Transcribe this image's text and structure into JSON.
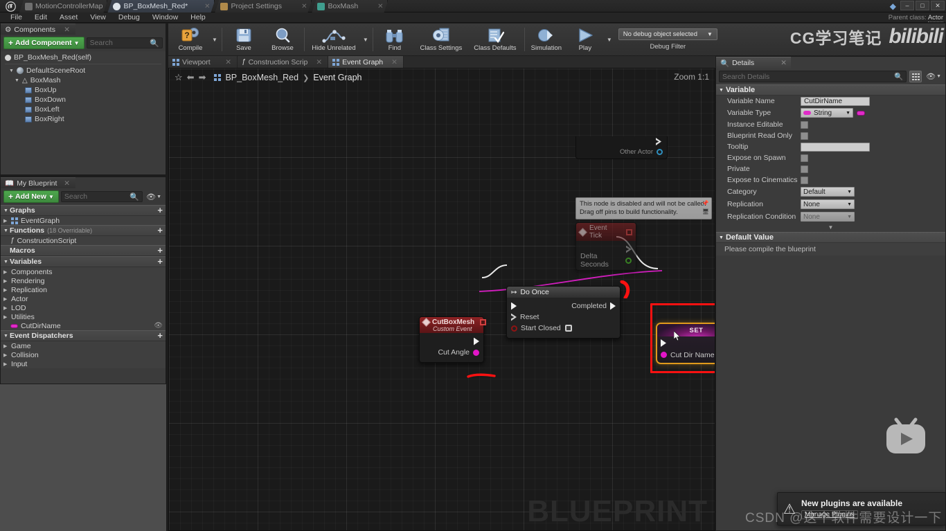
{
  "window": {
    "tabs": [
      {
        "label": "MotionControllerMap",
        "icon": "map-tab-icon",
        "active": false,
        "color": "#6f6f6f"
      },
      {
        "label": "BP_BoxMesh_Red*",
        "icon": "blueprint-tab-icon",
        "active": true,
        "color": "#dfe4ea"
      },
      {
        "label": "Project Settings",
        "icon": "settings-tab-icon",
        "active": false,
        "color": "#b08a4a"
      },
      {
        "label": "BoxMash",
        "icon": "mesh-tab-icon",
        "active": false,
        "color": "#3f9e8e"
      }
    ],
    "controls": {
      "minimize": "–",
      "maximize": "□",
      "close": "✕"
    },
    "parent_class_label": "Parent class:",
    "parent_class_value": "Actor"
  },
  "menubar": [
    "File",
    "Edit",
    "Asset",
    "View",
    "Debug",
    "Window",
    "Help"
  ],
  "toolbar": {
    "items": [
      {
        "label": "Compile",
        "icon": "compile-question-gear-icon",
        "has_caret": true
      },
      {
        "label": "Save",
        "icon": "save-floppy-icon",
        "has_caret": false
      },
      {
        "label": "Browse",
        "icon": "browse-magnifier-icon",
        "has_caret": false
      },
      {
        "label": "Hide Unrelated",
        "icon": "hide-unrelated-graph-icon",
        "has_caret": true
      },
      {
        "label": "Find",
        "icon": "find-binoculars-icon",
        "has_caret": false
      },
      {
        "label": "Class Settings",
        "icon": "class-settings-gear-icon",
        "has_caret": false
      },
      {
        "label": "Class Defaults",
        "icon": "class-defaults-checklist-icon",
        "has_caret": false
      },
      {
        "label": "Simulation",
        "icon": "simulation-gear-play-icon",
        "has_caret": false
      },
      {
        "label": "Play",
        "icon": "play-triangle-icon",
        "has_caret": true
      }
    ],
    "debug_object": "No debug object selected",
    "debug_filter_label": "Debug Filter"
  },
  "watermarks": {
    "brand_cn": "CG学习笔记",
    "brand_site": "bilibili",
    "graph_bg": "BLUEPRINT",
    "csdn": "CSDN @这个软件需要设计一下"
  },
  "components_panel": {
    "tab_label": "Components",
    "tab_icon": "components-icon",
    "add_button": "Add Component",
    "search_placeholder": "Search",
    "root_label": "BP_BoxMesh_Red(self)",
    "tree": [
      {
        "label": "DefaultSceneRoot",
        "depth": 1,
        "icon": "scene-root-icon",
        "expandable": true
      },
      {
        "label": "BoxMash",
        "depth": 2,
        "icon": "actor-icon",
        "expandable": true
      },
      {
        "label": "BoxUp",
        "depth": 3,
        "icon": "cube-icon",
        "expandable": false
      },
      {
        "label": "BoxDown",
        "depth": 3,
        "icon": "cube-icon",
        "expandable": false
      },
      {
        "label": "BoxLeft",
        "depth": 3,
        "icon": "cube-icon",
        "expandable": false
      },
      {
        "label": "BoxRight",
        "depth": 3,
        "icon": "cube-icon",
        "expandable": false
      }
    ]
  },
  "myblueprint_panel": {
    "tab_label": "My Blueprint",
    "tab_icon": "blueprint-book-icon",
    "add_button": "Add New",
    "search_placeholder": "Search",
    "sections": [
      {
        "title": "Graphs",
        "suffix": "",
        "items": [
          {
            "label": "EventGraph",
            "icon": "eventgraph-icon",
            "expandable": true
          }
        ]
      },
      {
        "title": "Functions",
        "suffix": "(18 Overridable)",
        "items": [
          {
            "label": "ConstructionScript",
            "icon": "function-icon",
            "expandable": false
          }
        ]
      },
      {
        "title": "Macros",
        "suffix": "",
        "items": []
      },
      {
        "title": "Variables",
        "suffix": "",
        "items": [
          {
            "label": "Components",
            "icon": "",
            "expandable": true
          },
          {
            "label": "Rendering",
            "icon": "",
            "expandable": true
          },
          {
            "label": "Replication",
            "icon": "",
            "expandable": true
          },
          {
            "label": "Actor",
            "icon": "",
            "expandable": true
          },
          {
            "label": "LOD",
            "icon": "",
            "expandable": true
          },
          {
            "label": "Utilities",
            "icon": "",
            "expandable": true
          },
          {
            "label": "CutDirName",
            "icon": "string-variable-icon",
            "expandable": false,
            "eye": true
          }
        ]
      },
      {
        "title": "Event Dispatchers",
        "suffix": "",
        "items": [
          {
            "label": "Game",
            "icon": "",
            "expandable": true
          },
          {
            "label": "Collision",
            "icon": "",
            "expandable": true
          },
          {
            "label": "Input",
            "icon": "",
            "expandable": true
          }
        ]
      }
    ]
  },
  "graph_tabs": [
    {
      "label": "Viewport",
      "icon": "viewport-icon",
      "active": false
    },
    {
      "label": "Construction Scrip",
      "icon": "function-icon",
      "active": false
    },
    {
      "label": "Event Graph",
      "icon": "eventgraph-icon",
      "active": true
    }
  ],
  "graph": {
    "favorite_icon": "star-icon",
    "back_icon": "arrow-left-icon",
    "forward_icon": "arrow-right-icon",
    "breadcrumb_icon": "eventgraph-icon",
    "breadcrumb_root": "BP_BoxMesh_Red",
    "breadcrumb_sep": "❯",
    "breadcrumb_leaf": "Event Graph",
    "zoom_label": "Zoom 1:1",
    "nodes": {
      "partial_top": {
        "pin_label": "Other Actor"
      },
      "event_tick": {
        "title": "Event Tick",
        "tooltip_line1": "This node is disabled and will not be called.",
        "tooltip_line2": "Drag off pins to build functionality.",
        "output_pin": "Delta Seconds"
      },
      "do_once": {
        "title": "Do Once",
        "out_exec": "Completed",
        "in_reset": "Reset",
        "in_start_closed": "Start Closed"
      },
      "cut_box_mesh": {
        "title": "CutBoxMesh",
        "subtitle": "Custom Event",
        "out_pin": "Cut Angle"
      },
      "set_node": {
        "title": "SET",
        "pin_label": "Cut Dir Name",
        "highlighted": true
      }
    }
  },
  "details_panel": {
    "tab_label": "Details",
    "tab_icon": "details-magnifier-icon",
    "search_placeholder": "Search Details",
    "sections": [
      {
        "title": "Variable",
        "rows": [
          {
            "label": "Variable Name",
            "type": "text",
            "value": "CutDirName"
          },
          {
            "label": "Variable Type",
            "type": "combo-type",
            "value": "String"
          },
          {
            "label": "Instance Editable",
            "type": "checkbox",
            "value": ""
          },
          {
            "label": "Blueprint Read Only",
            "type": "checkbox",
            "value": ""
          },
          {
            "label": "Tooltip",
            "type": "text",
            "value": ""
          },
          {
            "label": "Expose on Spawn",
            "type": "checkbox",
            "value": ""
          },
          {
            "label": "Private",
            "type": "checkbox",
            "value": ""
          },
          {
            "label": "Expose to Cinematics",
            "type": "checkbox",
            "value": ""
          },
          {
            "label": "Category",
            "type": "combo",
            "value": "Default"
          },
          {
            "label": "Replication",
            "type": "combo",
            "value": "None"
          },
          {
            "label": "Replication Condition",
            "type": "combo-disabled",
            "value": "None"
          }
        ]
      },
      {
        "title": "Default Value",
        "rows": [],
        "note": "Please compile the blueprint"
      }
    ]
  },
  "notification": {
    "icon": "warning-triangle-icon",
    "title": "New plugins are available",
    "action_label": "Manage Plugins"
  },
  "colors": {
    "accent_green": "#4ea74e",
    "highlight_orange": "#e09a1c",
    "annotation_red": "#fc1111",
    "string_pink": "#e215c8",
    "exec_white": "#f2f2f2",
    "event_red": "#8d2224"
  }
}
